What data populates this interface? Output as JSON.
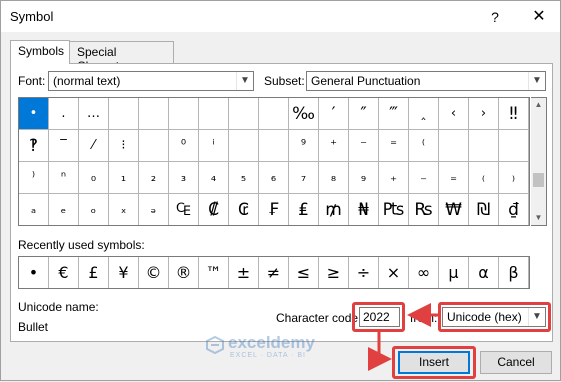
{
  "window": {
    "title": "Symbol",
    "help": "?",
    "close": "✕"
  },
  "tabs": [
    {
      "label": "Symbols",
      "active": true
    },
    {
      "label": "Special Characters",
      "active": false
    }
  ],
  "font": {
    "label": "Font:",
    "value": "(normal text)"
  },
  "subset": {
    "label": "Subset:",
    "value": "General Punctuation"
  },
  "grid": {
    "rows": [
      [
        "•",
        ".",
        "…",
        "",
        "",
        "",
        "",
        "",
        "",
        "‰",
        "′",
        "″",
        "‴",
        "‸",
        "‹",
        "›",
        "‼"
      ],
      [
        "‽",
        "‾",
        "⁄",
        "⁝",
        "",
        "⁰",
        "ⁱ",
        "",
        "",
        "⁹",
        "⁺",
        "⁻",
        "⁼",
        "⁽",
        "",
        "",
        ""
      ],
      [
        "⁾",
        "ⁿ",
        "₀",
        "₁",
        "₂",
        "₃",
        "₄",
        "₅",
        "₆",
        "₇",
        "₈",
        "₉",
        "₊",
        "₋",
        "₌",
        "₍",
        "₎"
      ],
      [
        "ₐ",
        "ₑ",
        "ₒ",
        "ₓ",
        "ₔ",
        "₠",
        "₡",
        "₢",
        "₣",
        "₤",
        "₥",
        "₦",
        "₧",
        "₨",
        "₩",
        "₪",
        "₫"
      ]
    ]
  },
  "recent": {
    "label": "Recently used symbols:",
    "symbols": [
      "•",
      "€",
      "£",
      "¥",
      "©",
      "®",
      "™",
      "±",
      "≠",
      "≤",
      "≥",
      "÷",
      "×",
      "∞",
      "µ",
      "α",
      "β"
    ]
  },
  "unicode_name": {
    "label": "Unicode name:",
    "value": "Bullet"
  },
  "char_code": {
    "label": "Character code:",
    "value": "2022"
  },
  "from": {
    "label": "from:",
    "value": "Unicode (hex)"
  },
  "buttons": {
    "insert": "Insert",
    "cancel": "Cancel"
  },
  "watermark": {
    "name": "exceldemy",
    "tagline": "EXCEL · DATA · BI"
  },
  "colors": {
    "highlight": "#e04040",
    "selection": "#0078d7"
  }
}
